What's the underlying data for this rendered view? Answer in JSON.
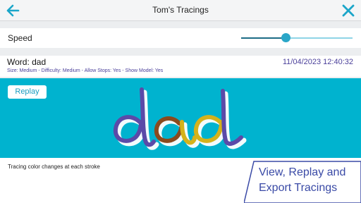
{
  "header": {
    "title": "Tom's Tracings",
    "back_icon": "arrow-left-icon",
    "close_icon": "close-icon",
    "accent": "#1ba6c9"
  },
  "speed": {
    "label": "Speed",
    "level": 0.4
  },
  "word": {
    "label": "Word: dad",
    "date": "11/04/2023 12:40:32",
    "meta": "Size: Medium - Difficulty: Medium - Allow Stops: Yes - Show Model: Yes"
  },
  "canvas": {
    "background": "#00b3cf",
    "replay_label": "Replay",
    "stroke_colors": [
      "#5b4aa8",
      "#8a4a1e",
      "#d4b21b",
      "#5b4aa8"
    ]
  },
  "footer": {
    "hint": "Tracing color changes at each stroke"
  },
  "promo": {
    "line1": "View, Replay and",
    "line2": "Export Tracings"
  }
}
